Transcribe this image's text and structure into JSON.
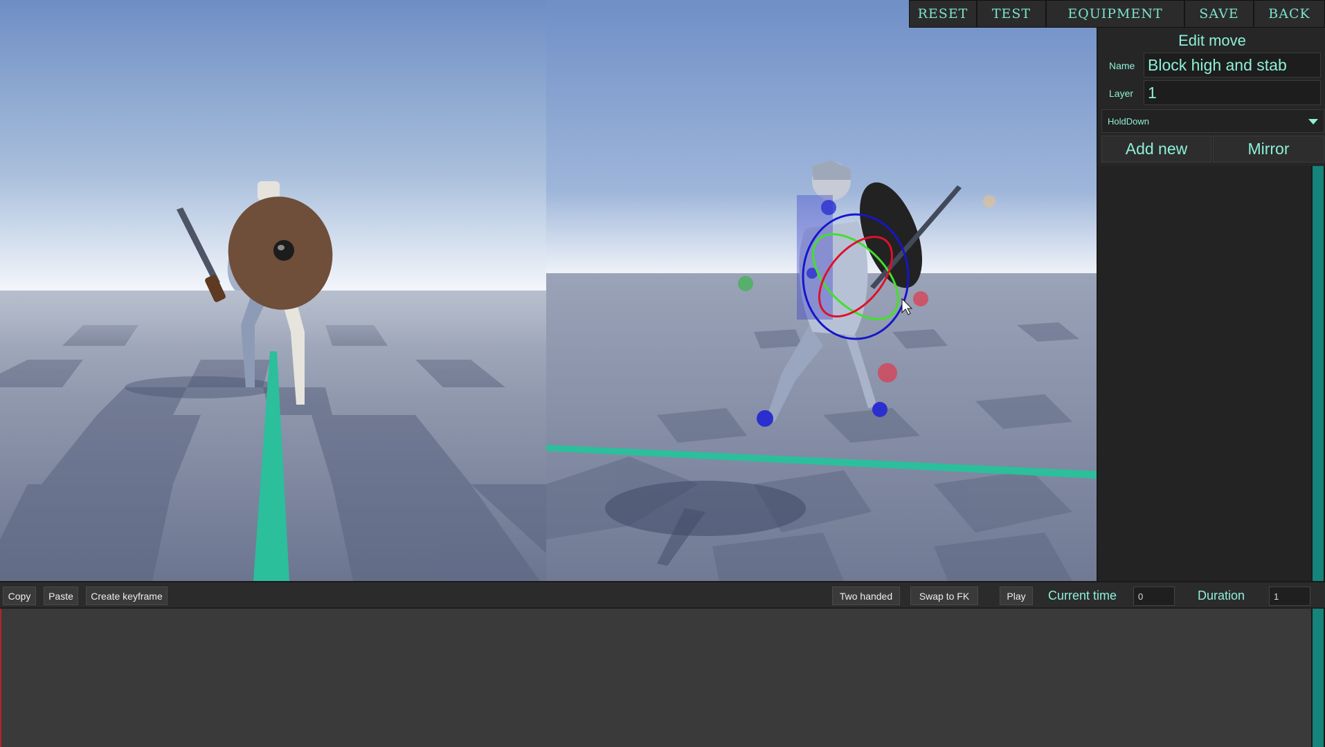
{
  "top_menu": {
    "reset": "RESET",
    "test": "TEST",
    "equipment": "EQUIPMENT",
    "save": "SAVE",
    "back": "BACK"
  },
  "panel": {
    "title": "Edit move",
    "name_label": "Name",
    "name_value": "Block high and stab",
    "layer_label": "Layer",
    "layer_value": "1",
    "mode_selected": "HoldDown",
    "add_new": "Add new",
    "mirror": "Mirror"
  },
  "timeline": {
    "copy": "Copy",
    "paste": "Paste",
    "create_keyframe": "Create keyframe",
    "two_handed": "Two handed",
    "swap_to_fk": "Swap to FK",
    "play": "Play",
    "current_time_label": "Current time",
    "current_time_value": "0",
    "duration_label": "Duration",
    "duration_value": "1"
  },
  "colors": {
    "accent_text": "#8ef0d7",
    "accent_teal": "#2bbf9c",
    "scrollbar": "#15847a",
    "playhead": "#b4242b",
    "gizmo_x": "#e0102a",
    "gizmo_y": "#43e02a",
    "gizmo_z": "#1616c8"
  },
  "icons": {
    "dropdown": "chevron-down-icon"
  }
}
